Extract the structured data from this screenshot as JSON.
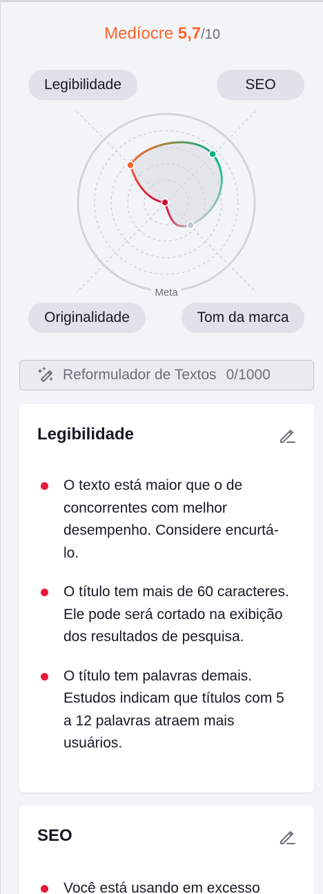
{
  "score": {
    "label": "Medíocre",
    "value": "5,7",
    "max": "/10"
  },
  "radar": {
    "axes": {
      "top_left": "Legibilidade",
      "top_right": "SEO",
      "bottom_left": "Originalidade",
      "bottom_right": "Tom da marca"
    },
    "goal_label": "Meta",
    "colors": {
      "legibilidade": "#ff642d",
      "seo": "#00b383",
      "originalidade": "#d0103a",
      "tom": "#c5c8d0"
    }
  },
  "rephraser": {
    "label": "Reformulador de Textos",
    "count": "0/1000",
    "icon": "magic-pen-icon"
  },
  "cards": [
    {
      "title": "Legibilidade",
      "edit_icon": "pencil-icon",
      "issues": [
        "O texto está maior que o de concorrentes com melhor desempenho. Considere encurtá-lo.",
        "O título tem mais de 60 caracteres. Ele pode será cortado na exibição dos resultados de pesquisa.",
        "O título tem palavras demais. Estudos indicam que títulos com 5 a 12 palavras atraem mais usuários."
      ]
    },
    {
      "title": "SEO",
      "edit_icon": "pencil-icon",
      "issues": [
        "Você está usando em excesso"
      ]
    }
  ],
  "colors": {
    "accent": "#ff642d",
    "error_dot": "#e61a3a"
  }
}
